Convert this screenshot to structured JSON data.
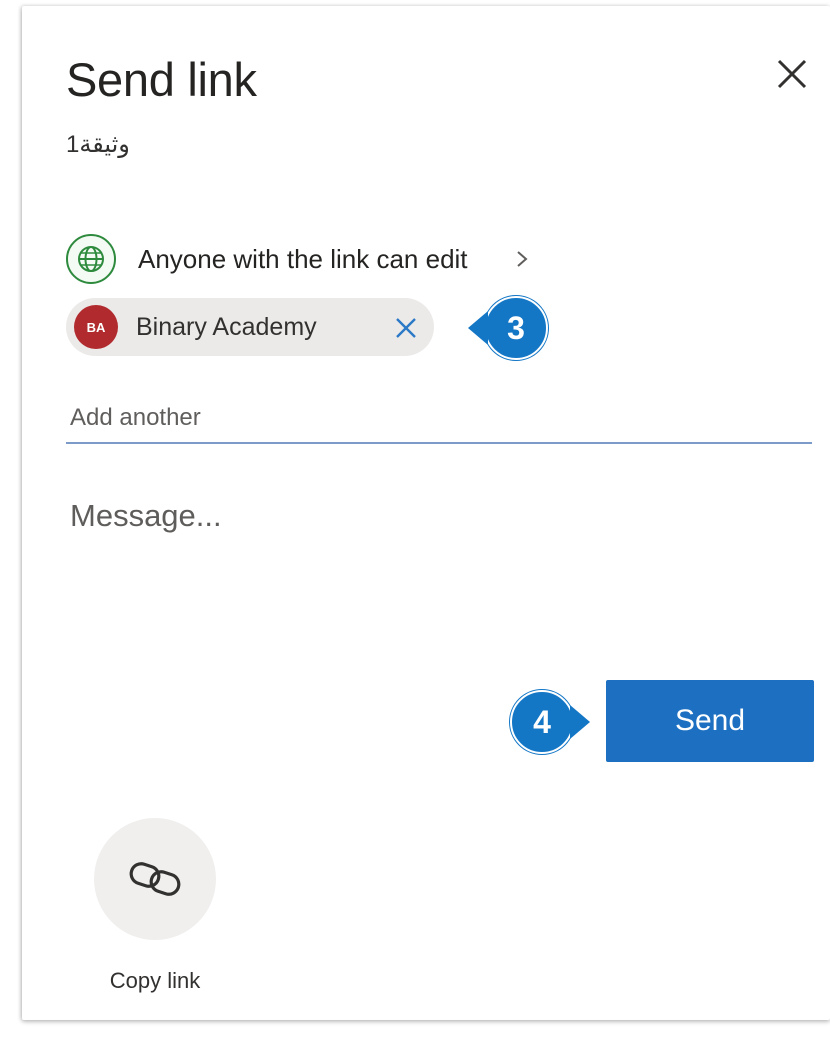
{
  "dialog": {
    "title": "Send link",
    "document_name": "وثيقة1",
    "close_icon": "close-icon"
  },
  "permission": {
    "label": "Anyone with the link can edit",
    "icon": "globe-icon",
    "icon_color": "#2e8b3e"
  },
  "recipients": [
    {
      "initials": "BA",
      "name": "Binary Academy",
      "avatar_color": "#b02a2e"
    }
  ],
  "add_input": {
    "placeholder": "Add another",
    "value": ""
  },
  "message": {
    "placeholder": "Message...",
    "value": ""
  },
  "send_button": {
    "label": "Send",
    "color": "#1c6fc1"
  },
  "copy_link": {
    "label": "Copy link",
    "icon": "link-icon"
  },
  "callouts": [
    {
      "number": "3",
      "color": "#1477c6"
    },
    {
      "number": "4",
      "color": "#1477c6"
    }
  ]
}
